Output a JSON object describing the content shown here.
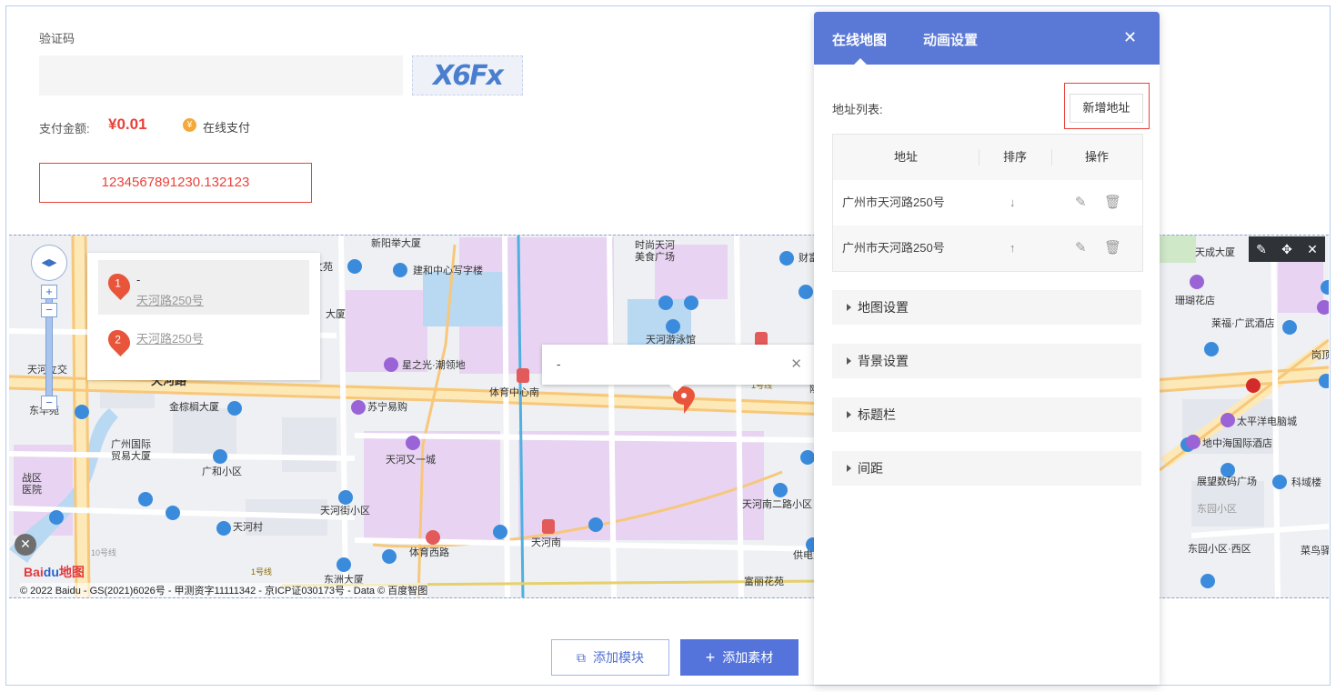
{
  "form": {
    "captcha_label": "验证码",
    "captcha_text": "X6Fx",
    "pay_label": "支付金额:",
    "pay_amount": "¥0.01",
    "pay_method": "在线支付",
    "coin_icon": "¥",
    "number_value": "1234567891230.132123"
  },
  "map": {
    "popup_items": [
      {
        "index": "1",
        "title": "-",
        "address": "天河路250号"
      },
      {
        "index": "2",
        "address": "天河路250号"
      }
    ],
    "infowindow_title": "-",
    "copyright": "© 2022 Baidu - GS(2021)6026号 - 甲测资字11111342 - 京ICP证030173号 - Data © 百度智图",
    "labels": [
      "新阳举大厦",
      "文苑",
      "建和中心写字楼",
      "时尚天河",
      "美食广场",
      "财富",
      "天成大厦",
      "珊瑚花店",
      "莱福·广武酒店",
      "大厦",
      "星之光·潮领地",
      "体育中心南",
      "天河立交",
      "天河路",
      "金棕榈大厦",
      "苏宁易购",
      "天河又一城",
      "广州国际",
      "贸易大厦",
      "广和小区",
      "天河街小区",
      "天河村",
      "天河南",
      "体育西路",
      "天河南二路小区",
      "东洲大厦",
      "富丽花苑",
      "供电大",
      "太平洋电脑城",
      "地中海国际酒店",
      "展望数码广场",
      "科域楼",
      "东园小区",
      "东园小区·西区",
      "菜鸟驿",
      "战区",
      "医院",
      "东华苑",
      "天河游泳馆",
      "岗顶",
      "1号线",
      "1号线",
      "10号线",
      "隆"
    ],
    "logo_baidu": "Bai",
    "logo_du": "du",
    "logo_map": "地图"
  },
  "bottom": {
    "add_module": "添加模块",
    "add_material": "添加素材"
  },
  "panel": {
    "tabs": [
      "在线地图",
      "动画设置"
    ],
    "address_list_label": "地址列表:",
    "add_address": "新增地址",
    "table_headers": [
      "地址",
      "排序",
      "操作"
    ],
    "rows": [
      {
        "address": "广州市天河路250号",
        "sort": "↓"
      },
      {
        "address": "广州市天河路250号",
        "sort": "↑"
      }
    ],
    "sections": [
      "地图设置",
      "背景设置",
      "标题栏",
      "间距"
    ]
  },
  "colors": {
    "accent": "#5a79d6",
    "danger": "#e8423a",
    "map_pin": "#e8553a"
  }
}
